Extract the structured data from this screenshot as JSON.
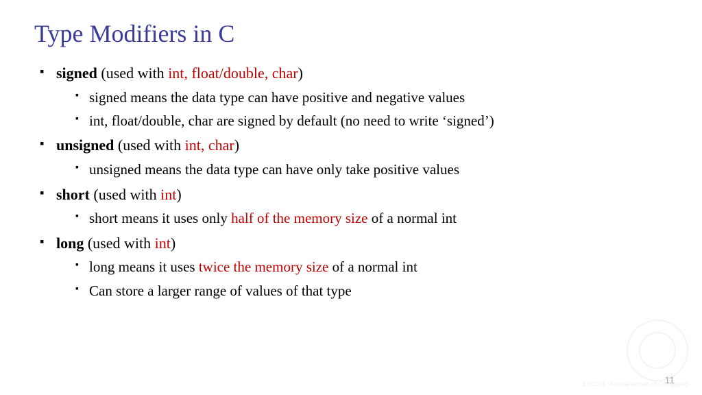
{
  "title": "Type Modifiers in C",
  "items": [
    {
      "keyword": "signed",
      "used_with_prefix": " (used with ",
      "used_with": "int, float/double, char",
      "used_with_suffix": ")",
      "subs": [
        {
          "text": "signed means the data type can have positive and negative values"
        },
        {
          "text": "int, float/double, char are signed by default (no need to write ‘signed’)"
        }
      ]
    },
    {
      "keyword": "unsigned",
      "used_with_prefix": " (used with ",
      "used_with": "int, char",
      "used_with_suffix": ")",
      "subs": [
        {
          "text": "unsigned means the data type can have only take positive values"
        }
      ]
    },
    {
      "keyword": "short",
      "used_with_prefix": " (used with ",
      "used_with": "int",
      "used_with_suffix": ")",
      "subs": [
        {
          "pre": "short means it uses only ",
          "red": "half of the memory size",
          "post": " of a normal int"
        }
      ]
    },
    {
      "keyword": "long",
      "used_with_prefix": " (used with ",
      "used_with": "int",
      "used_with_suffix": ")",
      "subs": [
        {
          "pre": "long means it uses ",
          "red": "twice the memory size",
          "post": " of a normal int"
        },
        {
          "text": "Can store a larger range of values of that type"
        }
      ]
    }
  ],
  "page_number": "11",
  "watermark_text": "ESC101 : Fundamentals\nof Computing"
}
